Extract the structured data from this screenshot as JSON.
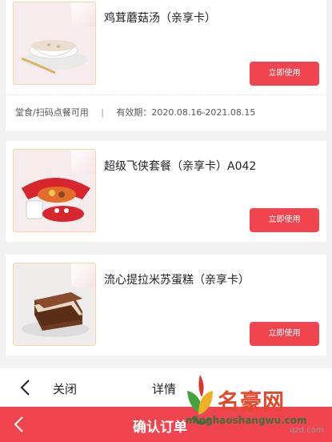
{
  "cards": [
    {
      "title": "鸡茸蘑菇汤（亲享卡）",
      "button_label": "立即使用",
      "footer": {
        "usage": "堂食/扫码点餐可用",
        "separator": "|",
        "validity": "有效期：2020.08.16-2021.08.15"
      }
    },
    {
      "title": "超级飞侠套餐（亲享卡）A042",
      "button_label": "立即使用"
    },
    {
      "title": "流心提拉米苏蛋糕（亲享卡）",
      "button_label": "立即使用"
    }
  ],
  "toolbar": {
    "close_label": "关闭",
    "details_label": "详情"
  },
  "bottom_bar": {
    "confirm_label": "确认订单"
  },
  "watermark": {
    "name": "名豪网",
    "site": "minghaoshangwu.com",
    "small": "qzd.com"
  },
  "colors": {
    "accent": "#f0454f",
    "background": "#f2f2f2",
    "card": "#ffffff"
  }
}
